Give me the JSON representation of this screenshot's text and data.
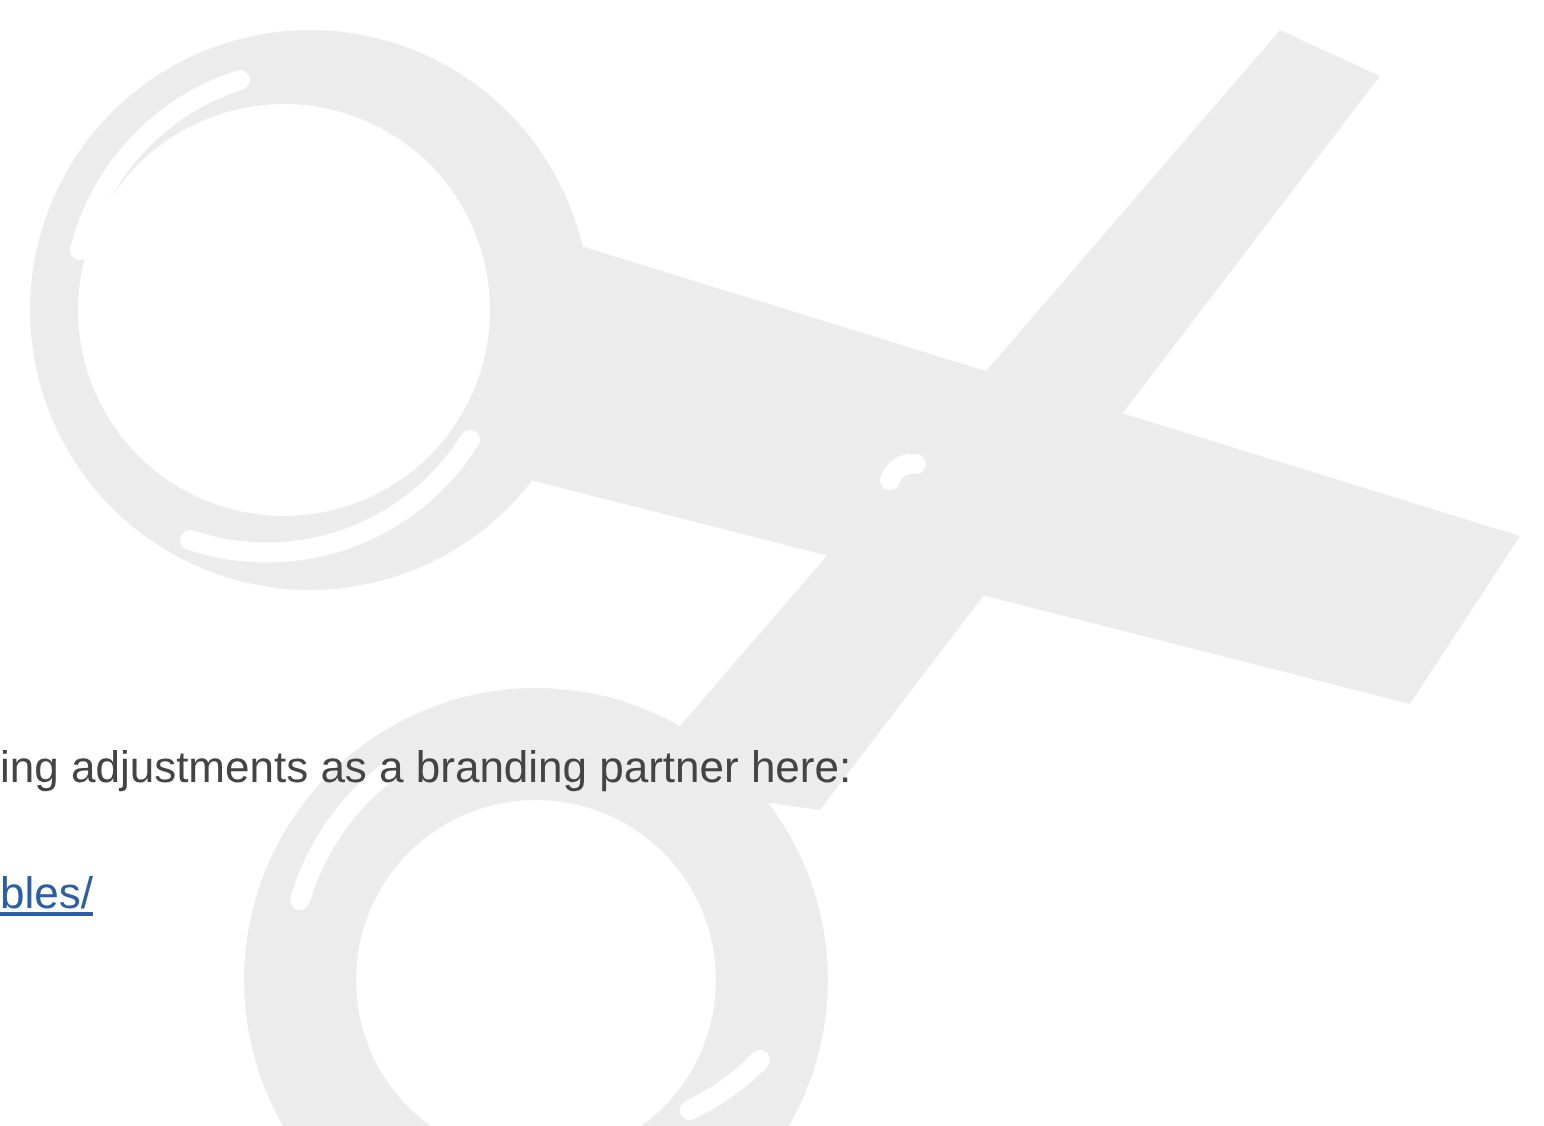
{
  "paragraph": {
    "text": "ing adjustments as a branding partner here:"
  },
  "link": {
    "text": "bles/"
  }
}
